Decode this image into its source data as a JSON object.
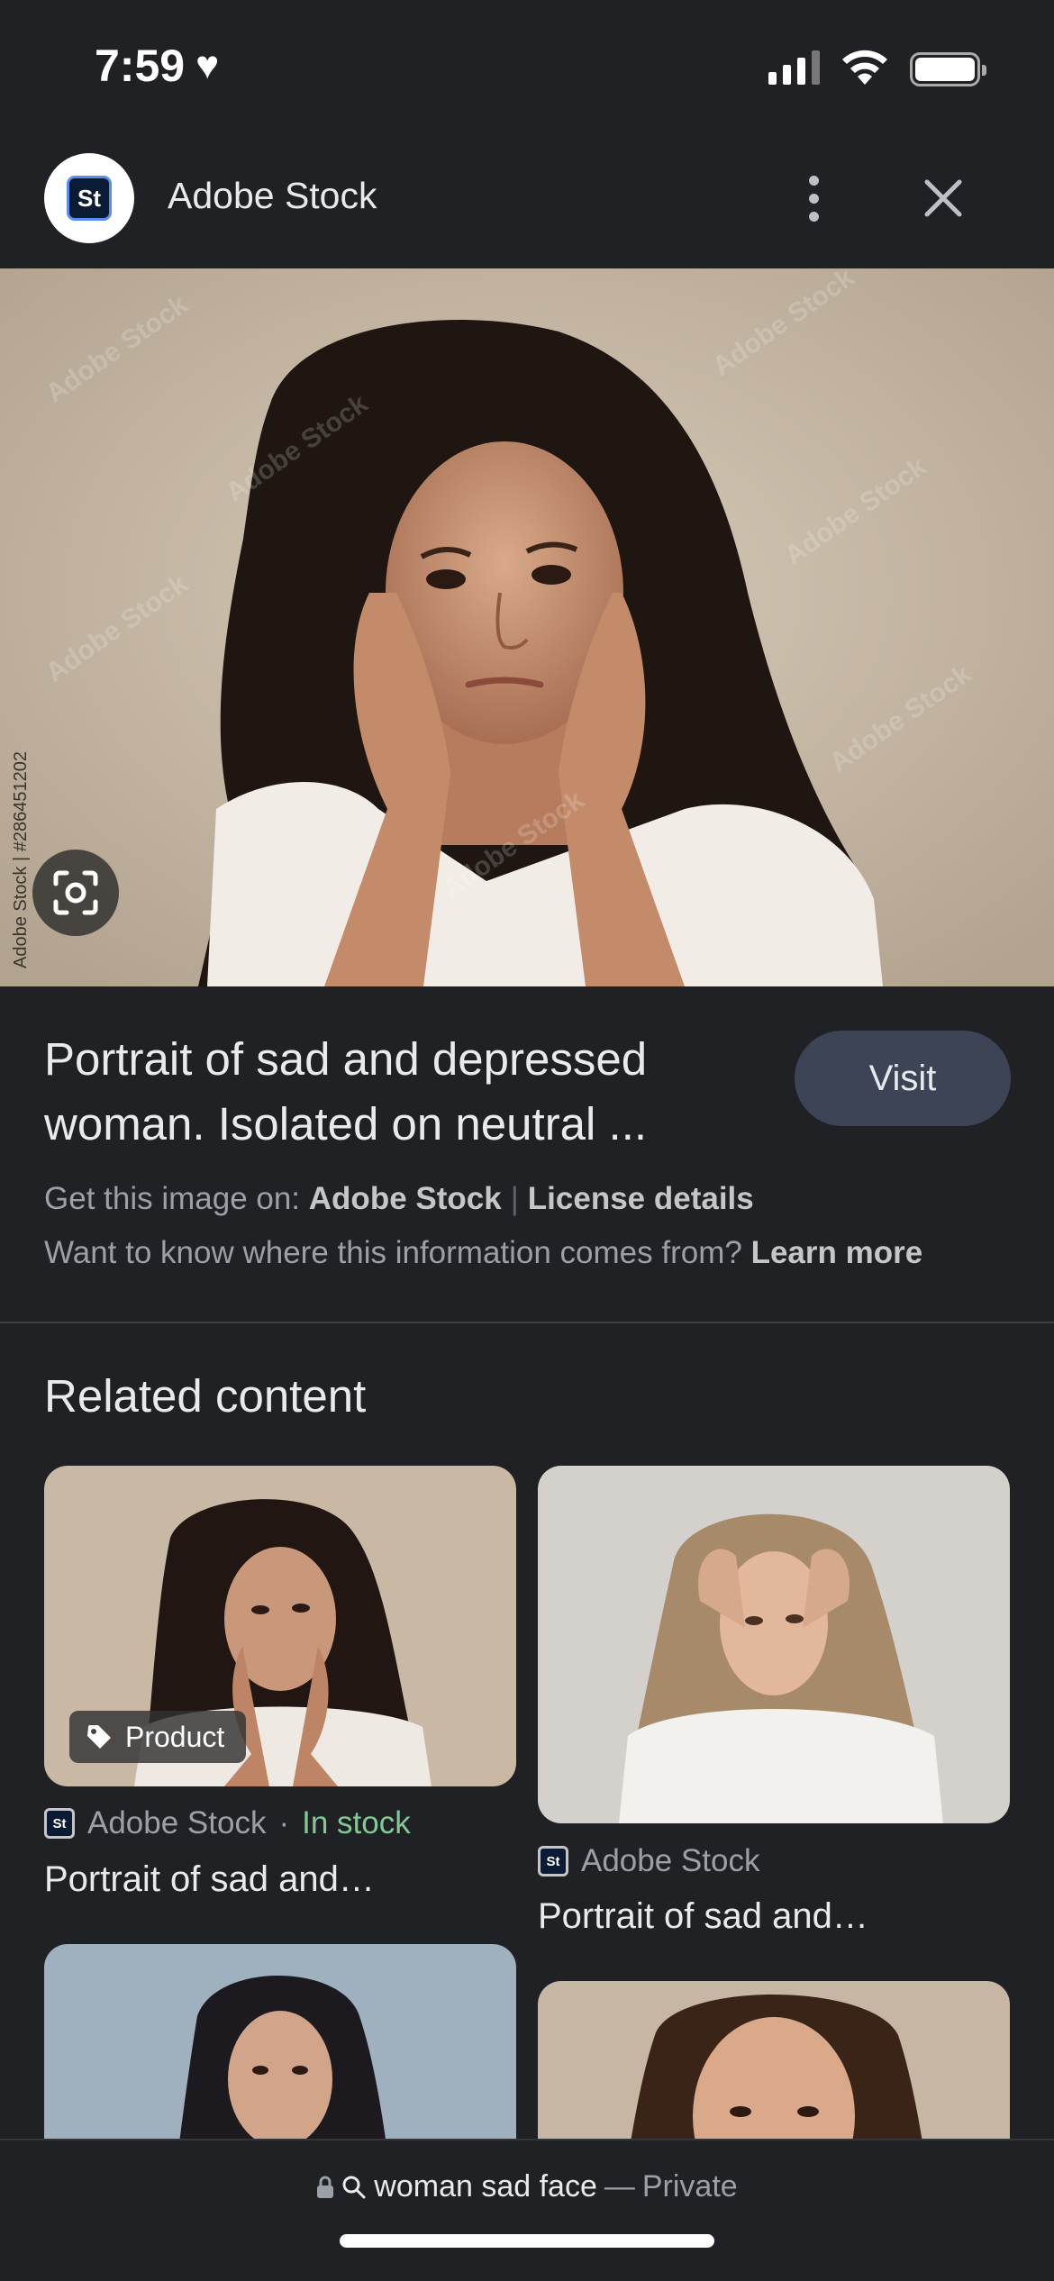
{
  "status_bar": {
    "time": "7:59"
  },
  "header": {
    "site_name": "Adobe Stock",
    "logo_text": "St"
  },
  "hero": {
    "watermark": "Adobe Stock",
    "credit": "Adobe Stock | #286451202"
  },
  "result": {
    "title": "Portrait of sad and depressed woman. Isolated on neutral ...",
    "visit_label": "Visit",
    "source_prefix": "Get this image on:",
    "source_name": "Adobe Stock",
    "license_label": "License details",
    "info_question": "Want to know where this information comes from?",
    "learn_more": "Learn more"
  },
  "related": {
    "heading": "Related content",
    "cards": [
      {
        "badge": "Product",
        "source": "Adobe Stock",
        "availability": "In stock",
        "title": "Portrait of sad and…"
      },
      {
        "source": "Adobe Stock",
        "title": "Portrait of sad and…"
      }
    ]
  },
  "bottom_bar": {
    "query": "woman sad face",
    "separator": "—",
    "mode": "Private"
  },
  "colors": {
    "background": "#202124",
    "visit_button": "#3c4456",
    "in_stock": "#81c995"
  }
}
